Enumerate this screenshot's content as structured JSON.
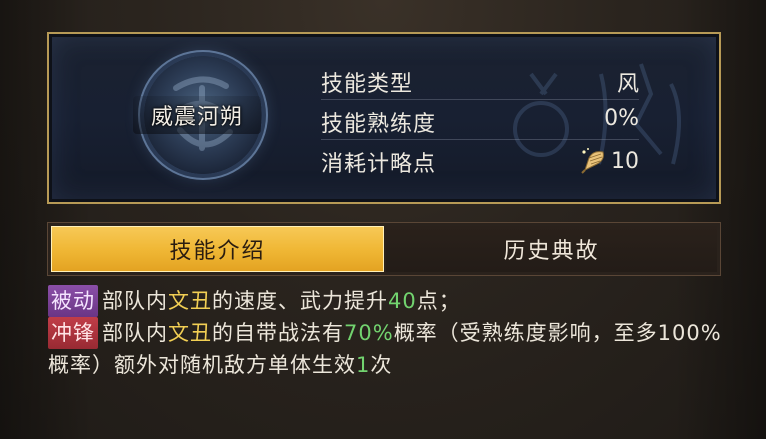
{
  "skill": {
    "name": "威震河朔",
    "stats": [
      {
        "label": "技能类型",
        "value": "风"
      },
      {
        "label": "技能熟练度",
        "value": "0%"
      },
      {
        "label": "消耗计略点",
        "value": "10",
        "icon": "strategy-fan-icon"
      }
    ]
  },
  "tabs": [
    {
      "label": "技能介绍",
      "active": true
    },
    {
      "label": "历史典故",
      "active": false
    }
  ],
  "description": {
    "passive": {
      "tag": "被动",
      "text_1": "部队内",
      "hero": "文丑",
      "text_2": "的速度、武力提升",
      "value": "40",
      "text_3": "点；"
    },
    "charge": {
      "tag": "冲锋",
      "text_1": "部队内",
      "hero": "文丑",
      "text_2": "的自带战法有",
      "percent": "70%",
      "text_3": "概率（受熟练度影响，至多100%概率）额外对随机敌方单体生效",
      "times": "1",
      "text_4": "次"
    }
  },
  "colors": {
    "gold_border": "#b79a56",
    "tab_active": "#f0b836",
    "tag_passive": "#8b4fa8",
    "tag_charge": "#c13d48",
    "highlight_yellow": "#f2cf54",
    "highlight_green": "#72d36f"
  }
}
